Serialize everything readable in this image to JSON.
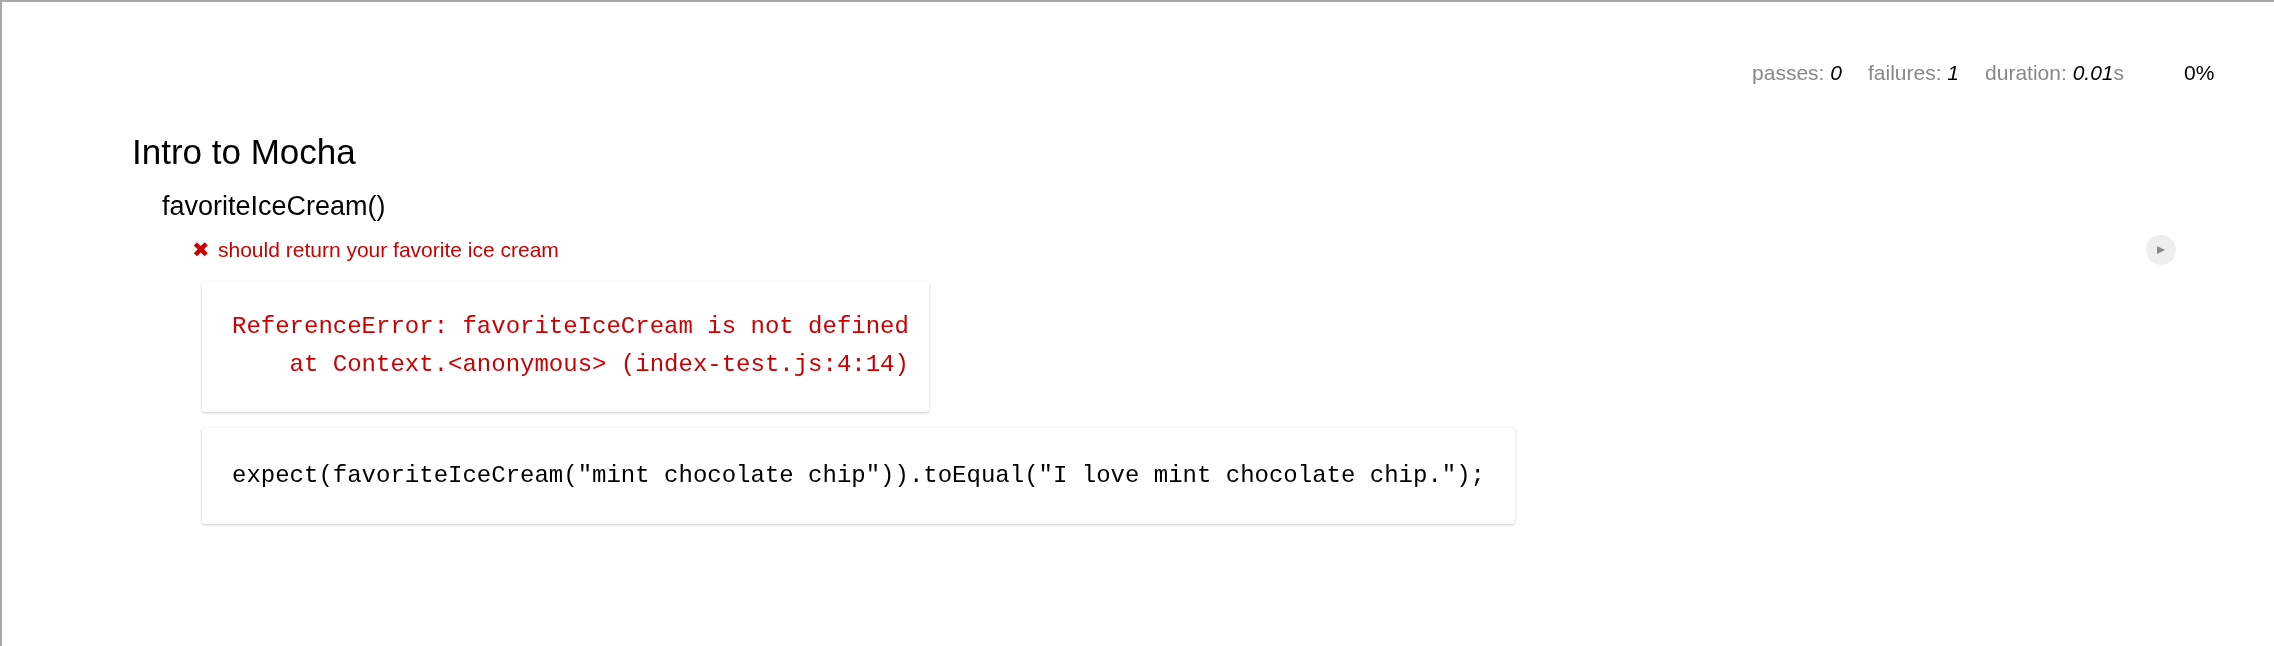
{
  "stats": {
    "passes_label": "passes:",
    "passes": "0",
    "failures_label": "failures:",
    "failures": "1",
    "duration_label": "duration:",
    "duration": "0.01",
    "duration_unit": "s",
    "progress": "0%"
  },
  "suites": [
    {
      "title": "Intro to Mocha",
      "children": [
        {
          "title": "favoriteIceCream()",
          "tests": [
            {
              "title": "should return your favorite ice cream",
              "kind": "fail",
              "mark": "✖",
              "error": [
                "ReferenceError: favoriteIceCream is not defined",
                "    at Context.<anonymous> (index-test.js:4:14)"
              ],
              "code": "expect(favoriteIceCream(\"mint chocolate chip\")).toEqual(\"I love mint chocolate chip.\");"
            }
          ]
        }
      ]
    }
  ]
}
